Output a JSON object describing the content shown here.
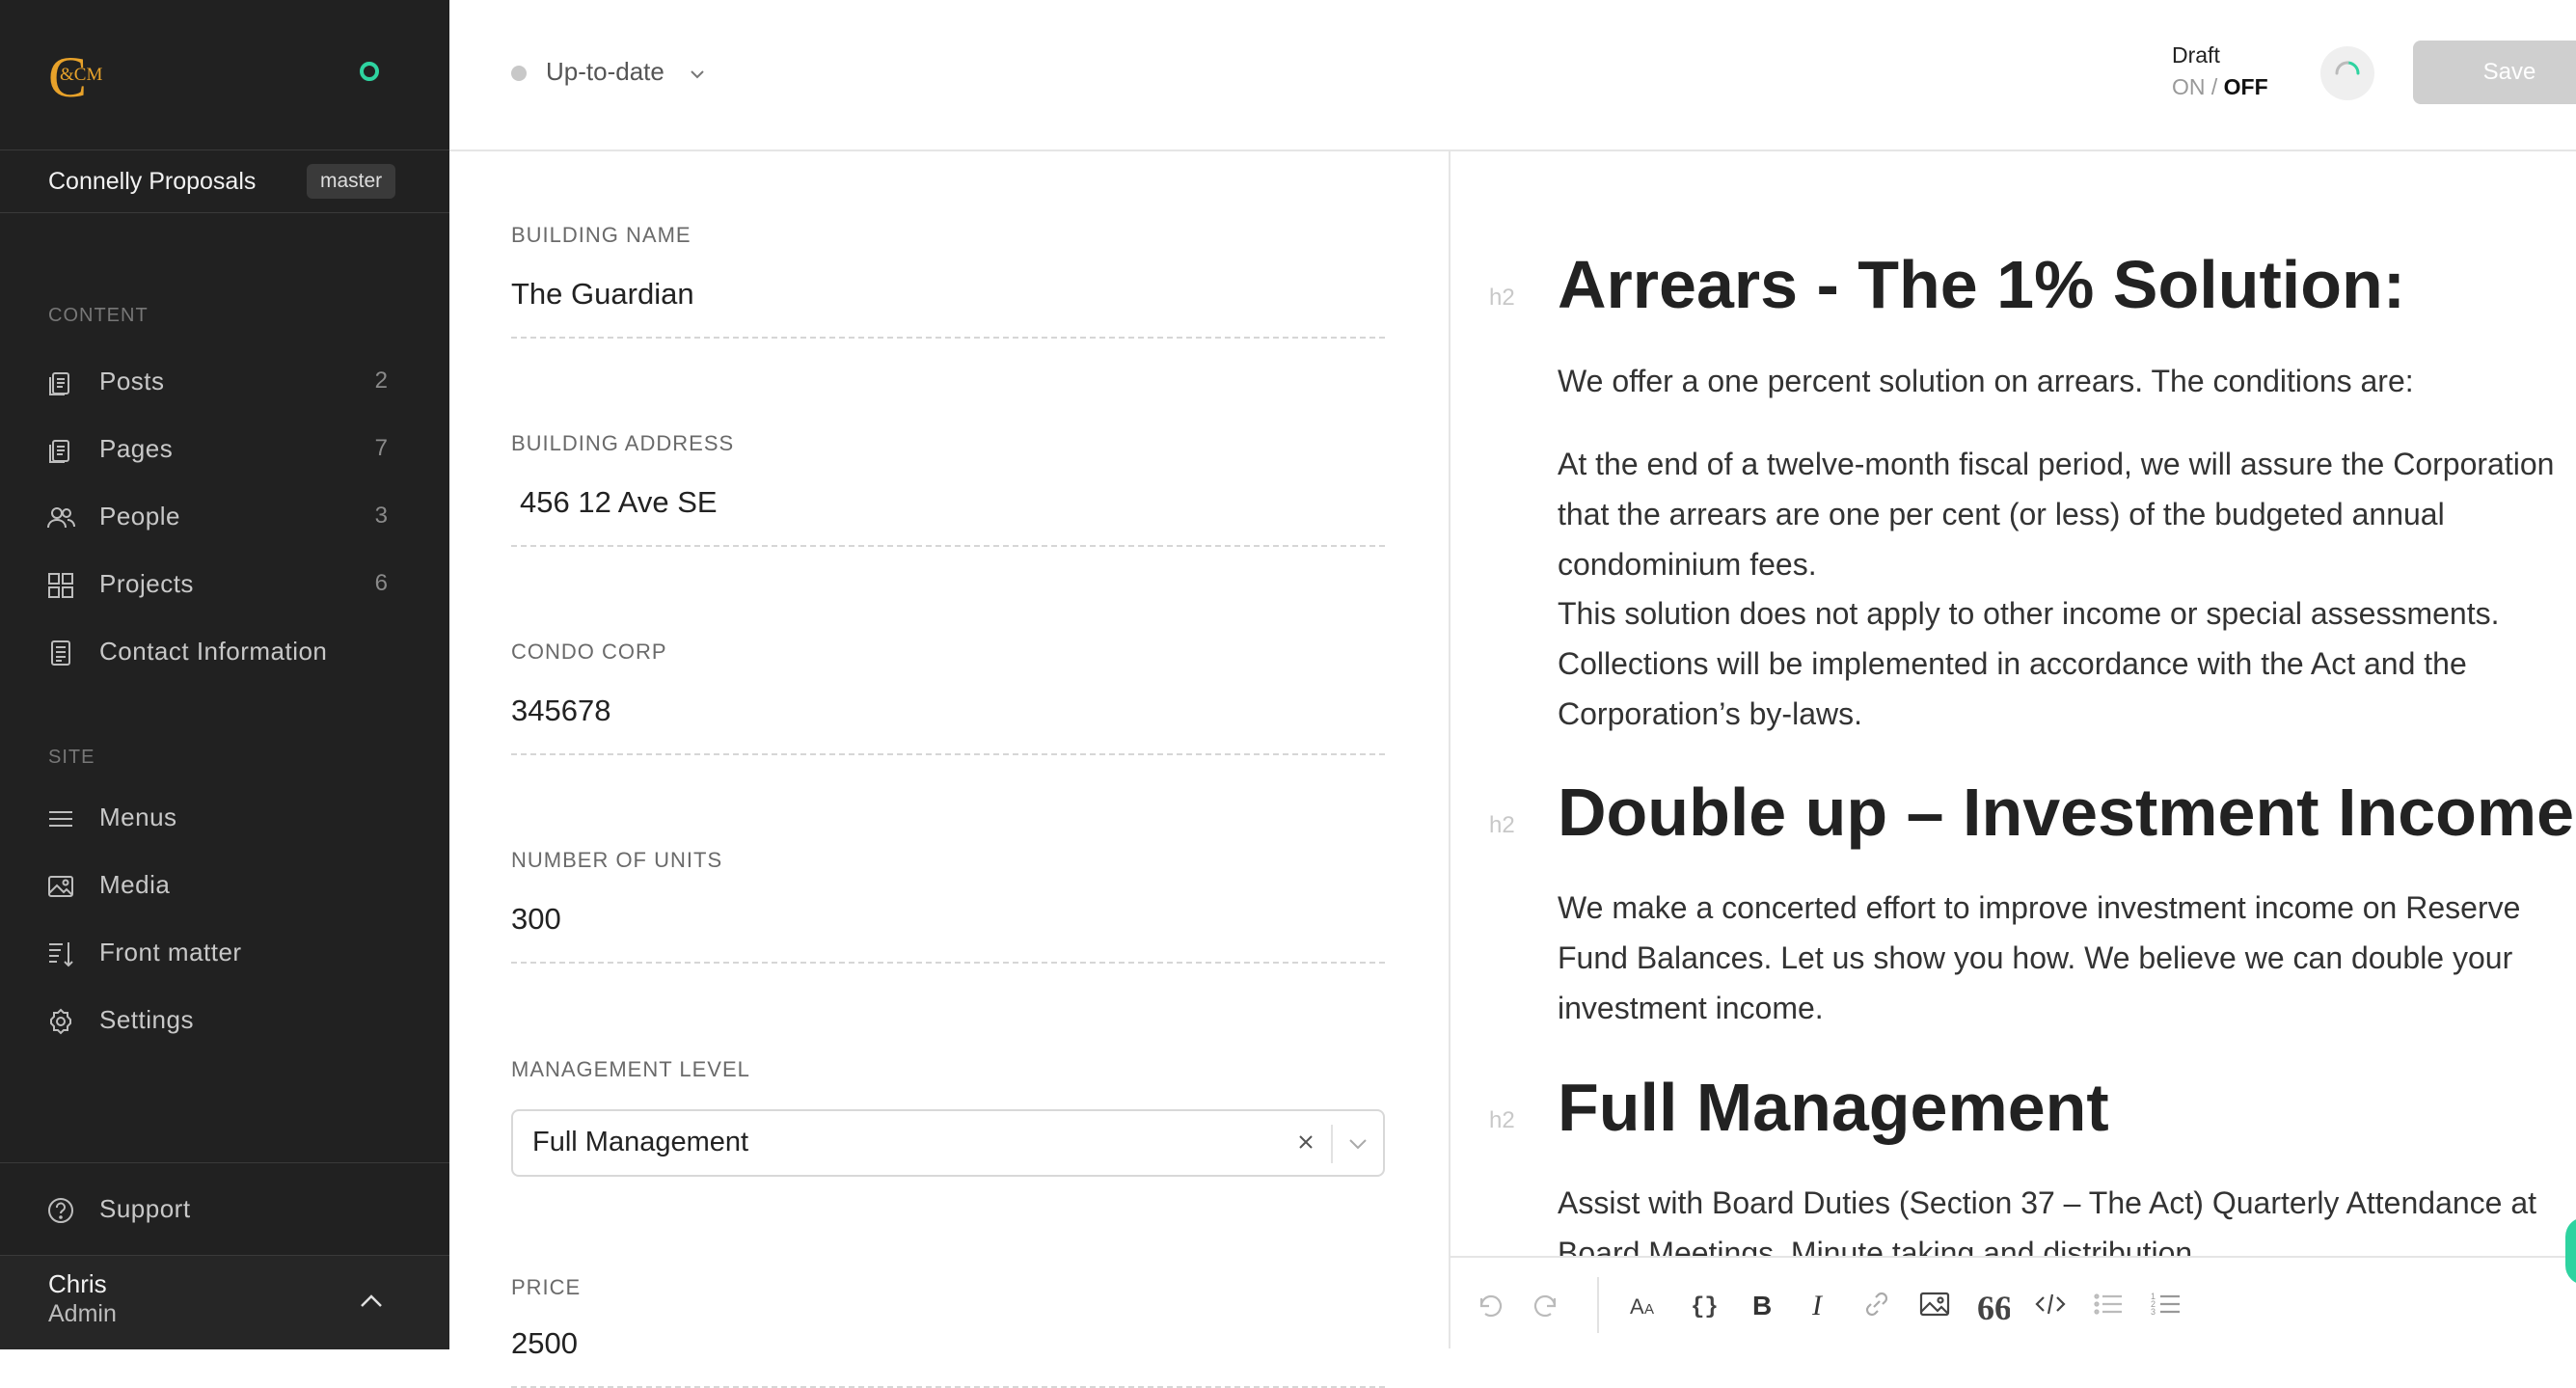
{
  "app": {
    "logo_text": "&CM",
    "repo_name": "Connelly Proposals",
    "branch": "master"
  },
  "sidebar": {
    "content_label": "CONTENT",
    "site_label": "SITE",
    "content_items": [
      {
        "label": "Posts",
        "count": "2",
        "icon": "document-icon"
      },
      {
        "label": "Pages",
        "count": "7",
        "icon": "document-icon"
      },
      {
        "label": "People",
        "count": "3",
        "icon": "people-icon"
      },
      {
        "label": "Projects",
        "count": "6",
        "icon": "grid-icon"
      },
      {
        "label": "Contact Information",
        "count": "",
        "icon": "document-icon"
      }
    ],
    "site_items": [
      {
        "label": "Menus",
        "icon": "menu-icon"
      },
      {
        "label": "Media",
        "icon": "image-icon"
      },
      {
        "label": "Front matter",
        "icon": "sort-icon"
      },
      {
        "label": "Settings",
        "icon": "gear-icon"
      }
    ],
    "support_label": "Support",
    "user": {
      "name": "Chris",
      "role": "Admin"
    }
  },
  "topbar": {
    "sync_status": "Up-to-date",
    "draft_label": "Draft",
    "draft_on": "ON",
    "draft_slash": "/",
    "draft_off": "OFF",
    "save_label": "Save"
  },
  "form": {
    "building_name_label": "BUILDING NAME",
    "building_name_value": "The Guardian",
    "building_address_label": "BUILDING ADDRESS",
    "building_address_value": "456 12 Ave SE",
    "condo_corp_label": "CONDO CORP",
    "condo_corp_value": "345678",
    "units_label": "NUMBER OF UNITS",
    "units_value": "300",
    "management_level_label": "MANAGEMENT LEVEL",
    "management_level_value": "Full Management",
    "price_label": "PRICE",
    "price_value": "2500"
  },
  "editor": {
    "h2_tag": "h2",
    "sections": [
      {
        "heading": "Arrears - The 1% Solution:",
        "p1": "We offer a one percent solution on arrears. The conditions are:",
        "p2": "At the end of a twelve-month fiscal period, we will assure the Corporation that the arrears are one per cent (or less) of the budgeted annual condominium fees.",
        "p3": "This solution does not apply to other income or special assessments.",
        "p4": "Collections will be implemented in accordance with the Act and the Corporation’s by-laws."
      },
      {
        "heading": "Double up – Investment Income:",
        "p1": "We make a concerted effort to improve investment income on Reserve Fund Balances. Let us show you how. We believe we can double your investment income."
      },
      {
        "heading": "Full Management",
        "p1": "Assist with Board Duties (Section 37 – The Act) Quarterly Attendance at Board Meetings. Minute taking and distribution"
      }
    ]
  },
  "colors": {
    "sidebar_bg": "#212121",
    "accent_green": "#2ed3a0",
    "logo_orange": "#e8a22a",
    "save_disabled": "#cfcfcf"
  }
}
